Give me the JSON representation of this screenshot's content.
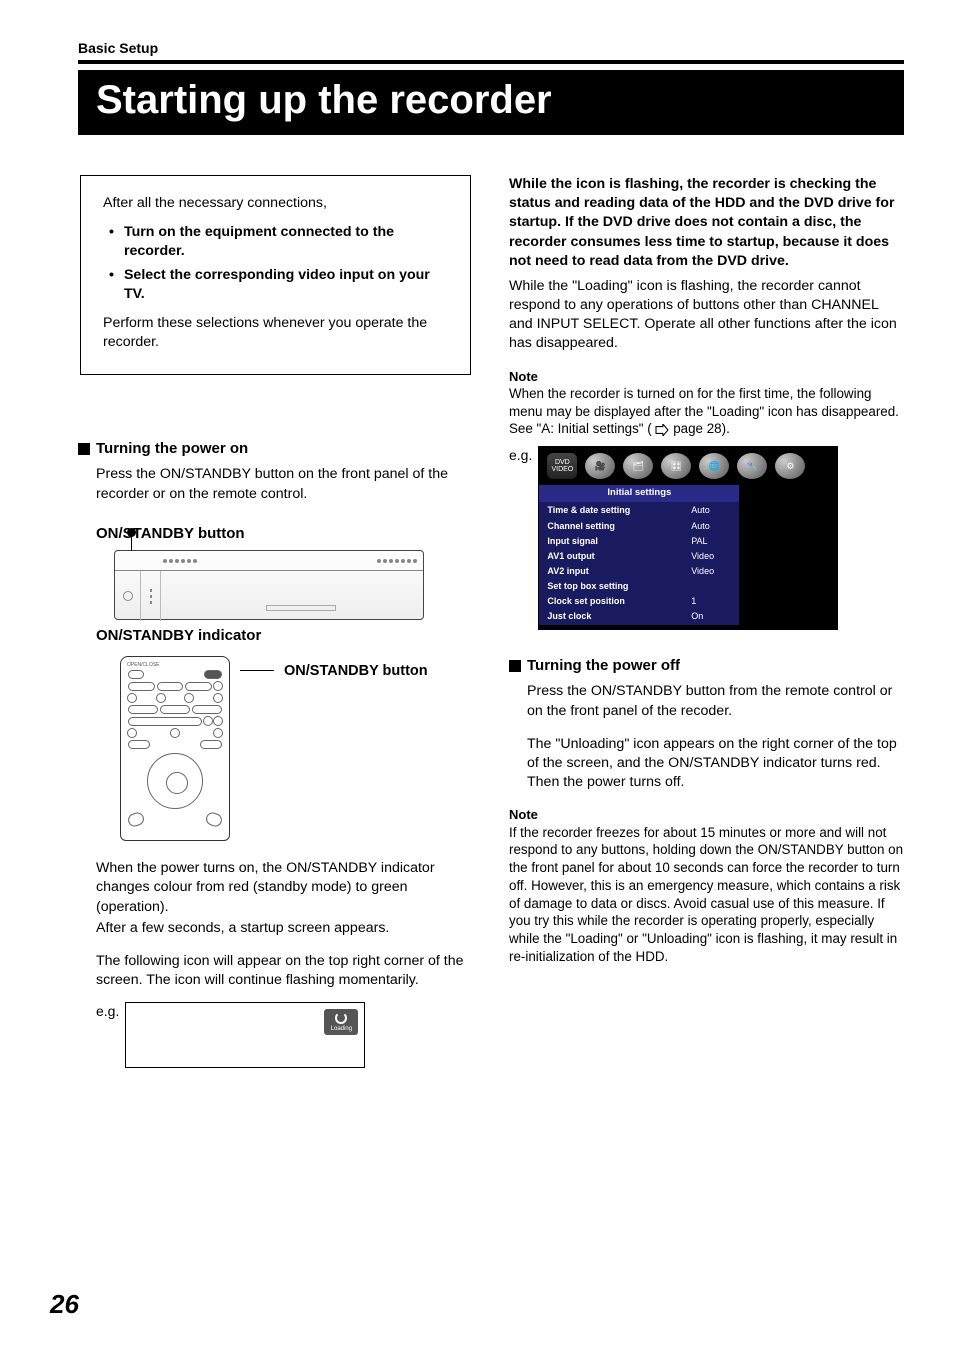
{
  "breadcrumb": "Basic Setup",
  "title": "Starting up the recorder",
  "intro": {
    "lead": "After all the necessary connections,",
    "bullets": [
      "Turn on the equipment connected to the recorder.",
      "Select the corresponding video input on your TV."
    ],
    "trail": "Perform these selections whenever you operate the recorder."
  },
  "left": {
    "h1": "Turning the power on",
    "p1": "Press the ON/STANDBY button on the front panel of the recorder or on the remote control.",
    "label_btn": "ON/STANDBY button",
    "label_ind": "ON/STANDBY indicator",
    "remote_label": "ON/STANDBY button",
    "p2": "When the power turns on, the ON/STANDBY indicator changes colour from red (standby mode) to green (operation).",
    "p3": "After a few seconds, a startup screen appears.",
    "p4": "The following icon will appear on the top right corner of the screen. The icon will continue flashing momentarily.",
    "eg": "e.g.",
    "loading": "Loading"
  },
  "right": {
    "bold1": "While the icon is flashing, the recorder is checking the status and reading data of the HDD and the DVD drive for startup. If the DVD drive does not contain a disc, the recorder consumes less time to startup, because it does not need to read data from the DVD drive.",
    "p1": "While the \"Loading\" icon is flashing, the recorder cannot respond to any operations of buttons other than CHANNEL and INPUT SELECT. Operate all other functions after the icon has disappeared.",
    "note_h": "Note",
    "note1a": "When the recorder is turned on for the first time, the following menu may be displayed after the \"Loading\" icon has disappeared. See \"A: Initial settings\" (",
    "note1b": " page 28).",
    "eg": "e.g.",
    "settings": {
      "title": "Initial settings",
      "rows": [
        [
          "Time & date setting",
          "Auto"
        ],
        [
          "Channel setting",
          "Auto"
        ],
        [
          "Input signal",
          "PAL"
        ],
        [
          "AV1 output",
          "Video"
        ],
        [
          "AV2 input",
          "Video"
        ],
        [
          "Set top box setting",
          ""
        ],
        [
          "Clock set position",
          "1"
        ],
        [
          "Just clock",
          "On"
        ]
      ]
    },
    "h2": "Turning the power off",
    "p2": "Press the ON/STANDBY button from the remote control or on the front panel of the recoder.",
    "p3": "The \"Unloading\" icon appears on the right corner of the top of the screen, and the ON/STANDBY indicator turns red. Then the power turns off.",
    "note2": "If the recorder freezes for about 15 minutes or more and will not respond to any buttons, holding down the ON/STANDBY button on the front panel for about 10 seconds can force the recorder to turn off. However, this is an emergency measure, which contains a risk of damage to data or discs. Avoid casual use of this measure. If you try this while the recorder is operating properly, especially while the \"Loading\" or \"Unloading\" icon is flashing, it may result in re-initialization of the HDD."
  },
  "page_number": "26"
}
